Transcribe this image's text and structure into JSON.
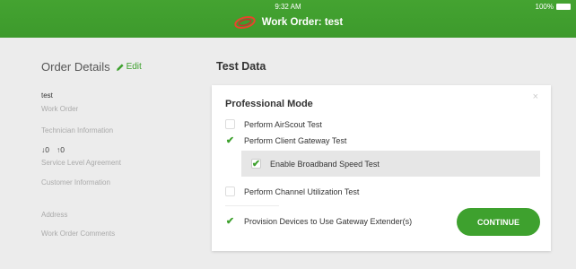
{
  "status_bar": {
    "time": "9:32 AM",
    "battery": "100%"
  },
  "header": {
    "title": "Work Order: test",
    "logo_icon": "swirl-logo-icon"
  },
  "order_details": {
    "title": "Order Details",
    "edit_label": "Edit",
    "work_order_value": "test",
    "work_order_label": "Work Order",
    "technician_label": "Technician Information",
    "sla_down": "↓0",
    "sla_up": "↑0",
    "sla_label": "Service Level Agreement",
    "customer_label": "Customer Information",
    "address_label": "Address",
    "comments_label": "Work Order Comments"
  },
  "main": {
    "title": "Test Data",
    "card": {
      "title": "Professional Mode",
      "close": "×",
      "options": [
        {
          "label": "Perform AirScout Test",
          "checked": false
        },
        {
          "label": "Perform Client Gateway Test",
          "checked": true
        },
        {
          "label": "Enable Broadband Speed Test",
          "checked": true
        },
        {
          "label": "Perform Channel Utilization Test",
          "checked": false
        },
        {
          "label": "Provision Devices to Use Gateway Extender(s)",
          "checked": true
        }
      ],
      "continue_label": "CONTINUE"
    }
  },
  "colors": {
    "accent": "#3ea12e",
    "header_bg": "#44a331",
    "background": "#ececec"
  }
}
